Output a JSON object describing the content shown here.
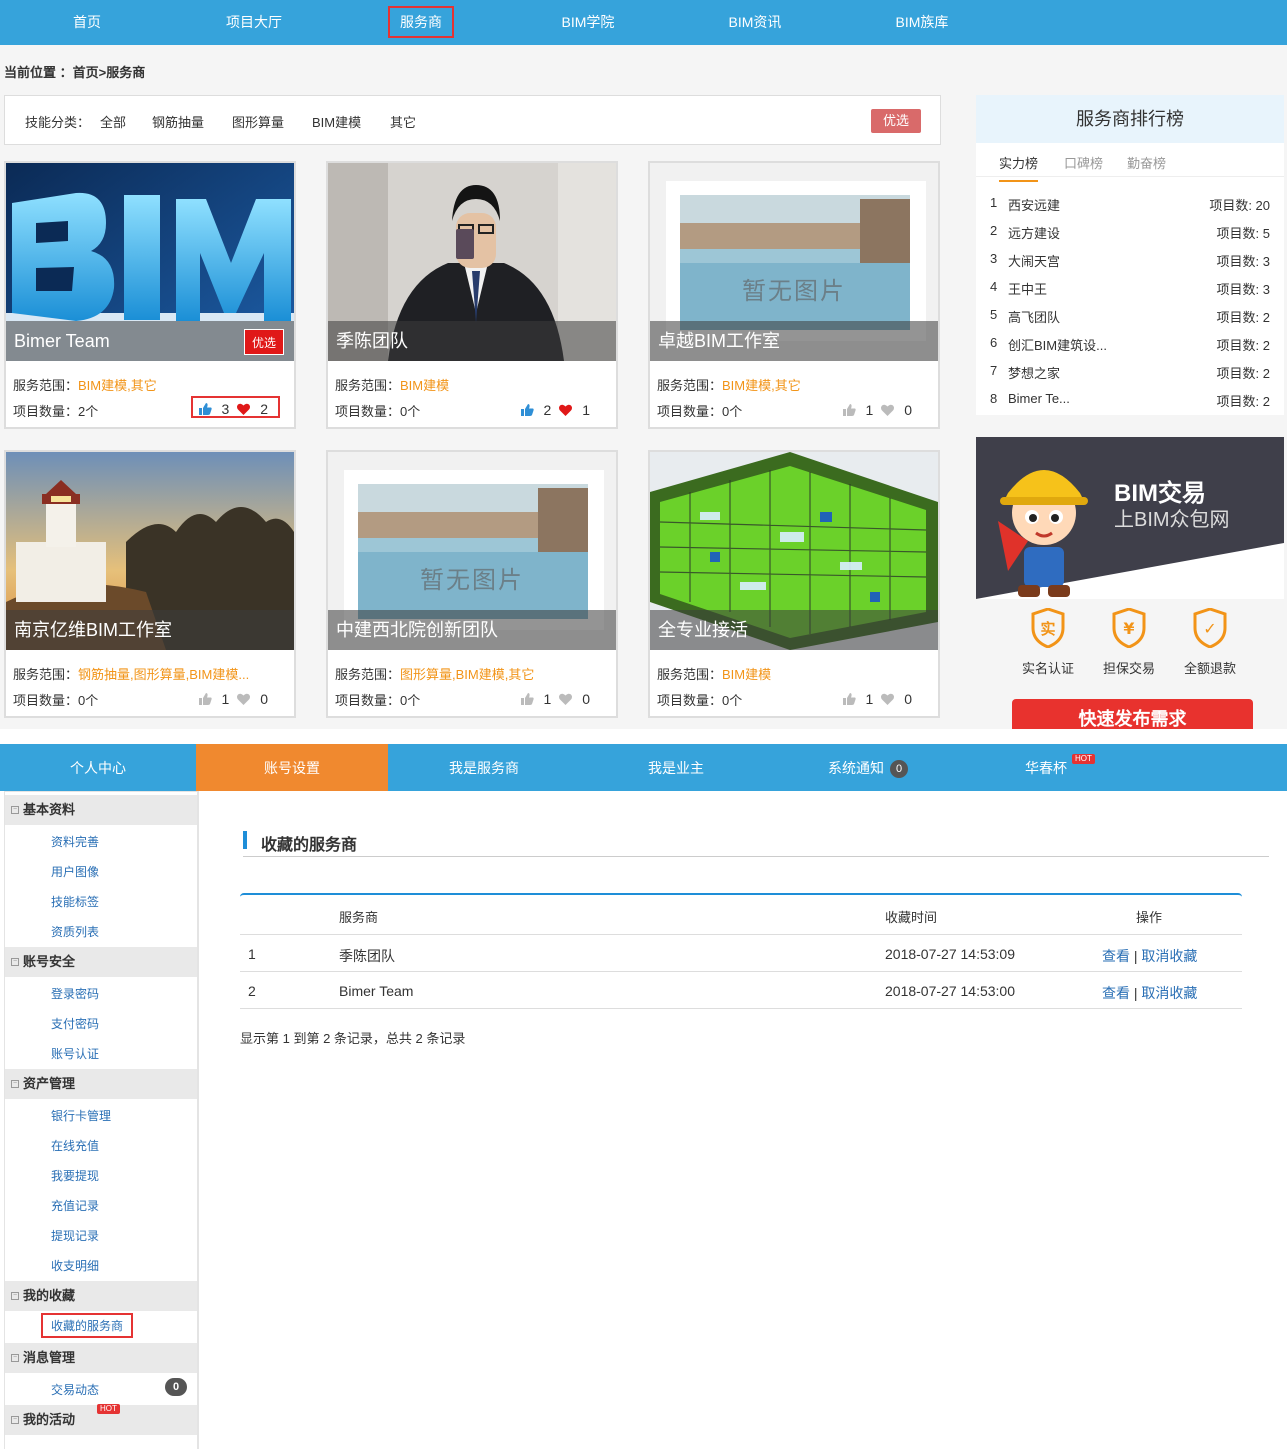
{
  "top_nav": [
    "首页",
    "项目大厅",
    "服务商",
    "BIM学院",
    "BIM资讯",
    "BIM族库"
  ],
  "breadcrumb": "当前位置 ：首页>服务商",
  "filter": {
    "label": "技能分类：",
    "options": [
      "全部",
      "钢筋抽量",
      "图形算量",
      "BIM建模",
      "其它"
    ],
    "pick_button": "优选"
  },
  "cards": [
    {
      "name": "Bimer Team",
      "badge": "优选",
      "scope_label": "服务范围：",
      "scope": "BIM建模,其它",
      "count": "项目数量：2个",
      "likes": "3",
      "favs": "2",
      "image": "bim-logo"
    },
    {
      "name": "季陈团队",
      "badge": "",
      "scope_label": "服务范围：",
      "scope": "BIM建模",
      "count": "项目数量：0个",
      "likes": "2",
      "favs": "1",
      "image": "portrait"
    },
    {
      "name": "卓越BIM工作室",
      "badge": "",
      "scope_label": "服务范围：",
      "scope": "BIM建模,其它",
      "count": "项目数量：0个",
      "likes": "1",
      "favs": "0",
      "image": "no-image"
    },
    {
      "name": "南京亿维BIM工作室",
      "badge": "",
      "scope_label": "服务范围：",
      "scope": "钢筋抽量,图形算量,BIM建模...",
      "count": "项目数量：0个",
      "likes": "1",
      "favs": "0",
      "image": "lighthouse"
    },
    {
      "name": "中建西北院创新团队",
      "badge": "",
      "scope_label": "服务范围：",
      "scope": "图形算量,BIM建模,其它",
      "count": "项目数量：0个",
      "likes": "1",
      "favs": "0",
      "image": "no-image"
    },
    {
      "name": "全专业接活",
      "badge": "",
      "scope_label": "服务范围：",
      "scope": "BIM建模",
      "count": "项目数量：0个",
      "likes": "1",
      "favs": "0",
      "image": "bim-model"
    }
  ],
  "no_image_text": "暂无图片",
  "ranking": {
    "title": "服务商排行榜",
    "tabs": [
      "实力榜",
      "口碑榜",
      "勤奋榜"
    ],
    "rows": [
      {
        "n": "1",
        "name": "西安远建",
        "count": "项目数:  20"
      },
      {
        "n": "2",
        "name": "远方建设",
        "count": "项目数:  5"
      },
      {
        "n": "3",
        "name": "大闹天宫",
        "count": "项目数:  3"
      },
      {
        "n": "4",
        "name": "王中王",
        "count": "项目数:  3"
      },
      {
        "n": "5",
        "name": "高飞团队",
        "count": "项目数:  2"
      },
      {
        "n": "6",
        "name": "创汇BIM建筑设...",
        "count": "项目数:  2"
      },
      {
        "n": "7",
        "name": "梦想之家",
        "count": "项目数:  2"
      },
      {
        "n": "8",
        "name": "Bimer Te...",
        "count": "项目数:  2"
      }
    ]
  },
  "banner": {
    "title": "BIM交易",
    "subtitle": "上BIM众包网"
  },
  "features": [
    "实名认证",
    "担保交易",
    "全额退款"
  ],
  "feature_icon_chars": [
    "实",
    "¥",
    "✓"
  ],
  "publish_button": "快速发布需求",
  "tabs": [
    {
      "label": "个人中心",
      "count": "",
      "hot": ""
    },
    {
      "label": "账号设置",
      "count": "",
      "hot": ""
    },
    {
      "label": "我是服务商",
      "count": "",
      "hot": ""
    },
    {
      "label": "我是业主",
      "count": "",
      "hot": ""
    },
    {
      "label": "系统通知",
      "count": "0",
      "hot": ""
    },
    {
      "label": "华春杯",
      "count": "",
      "hot": "HOT"
    }
  ],
  "sidebar": [
    {
      "group": "基本资料",
      "items": [
        "资料完善",
        "用户图像",
        "技能标签",
        "资质列表"
      ]
    },
    {
      "group": "账号安全",
      "items": [
        "登录密码",
        "支付密码",
        "账号认证"
      ]
    },
    {
      "group": "资产管理",
      "items": [
        "银行卡管理",
        "在线充值",
        "我要提现",
        "充值记录",
        "提现记录",
        "收支明细"
      ]
    },
    {
      "group": "我的收藏",
      "items": [
        "收藏的服务商"
      ]
    },
    {
      "group": "消息管理",
      "items": [
        "交易动态"
      ],
      "badge": "0"
    },
    {
      "group": "我的活动",
      "items": [],
      "hot": "HOT"
    }
  ],
  "page_title": "收藏的服务商",
  "table": {
    "headers": [
      "服务商",
      "收藏时间",
      "操作"
    ],
    "rows": [
      {
        "no": "1",
        "name": "季陈团队",
        "time": "2018-07-27 14:53:09",
        "view": "查看",
        "sep": "|",
        "cancel": "取消收藏"
      },
      {
        "no": "2",
        "name": "Bimer Team",
        "time": "2018-07-27 14:53:00",
        "view": "查看",
        "sep": "|",
        "cancel": "取消收藏"
      }
    ]
  },
  "summary": "显示第 1 到第 2 条记录，总共 2 条记录",
  "colors": {
    "nav_blue": "#36a3db",
    "active_orange": "#f0892f",
    "accent_orange": "#f29418",
    "red": "#e53333",
    "link_blue": "#2a6fb5"
  }
}
